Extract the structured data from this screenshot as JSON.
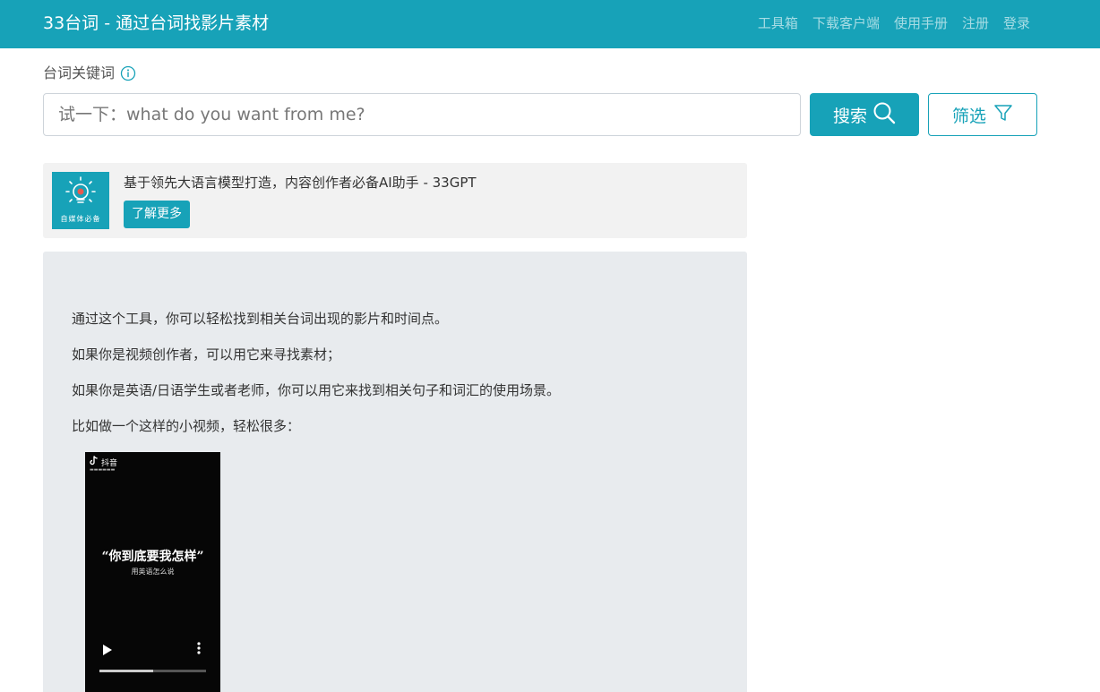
{
  "header": {
    "brand": "33台词 - 通过台词找影片素材",
    "nav": [
      "工具箱",
      "下载客户端",
      "使用手册",
      "注册",
      "登录"
    ]
  },
  "search": {
    "label": "台词关键词",
    "placeholder": "试一下：what do you want from me?",
    "value": "",
    "search_label": "搜索",
    "filter_label": "筛选"
  },
  "ad": {
    "logo_text": "自媒体必备",
    "text": "基于领先大语言模型打造，内容创作者必备AI助手 - 33GPT",
    "button": "了解更多"
  },
  "intro": {
    "paragraphs": [
      "通过这个工具，你可以轻松找到相关台词出现的影片和时间点。",
      "如果你是视频创作者，可以用它来寻找素材；",
      "如果你是英语/日语学生或者老师，你可以用它来找到相关句子和词汇的使用场景。",
      "比如做一个这样的小视频，轻松很多："
    ]
  },
  "video": {
    "app_name": "抖音",
    "title": "“你到底要我怎样”",
    "subtitle": "用英语怎么说",
    "progress": 0.5
  },
  "colors": {
    "accent": "#17a2b8",
    "panel": "#e8ebee",
    "ad_bg": "#f2f2f2"
  },
  "icons": [
    "info-icon",
    "search-icon",
    "filter-icon",
    "lightbulb-icon",
    "tiktok-icon",
    "play-icon",
    "more-vertical-icon"
  ]
}
